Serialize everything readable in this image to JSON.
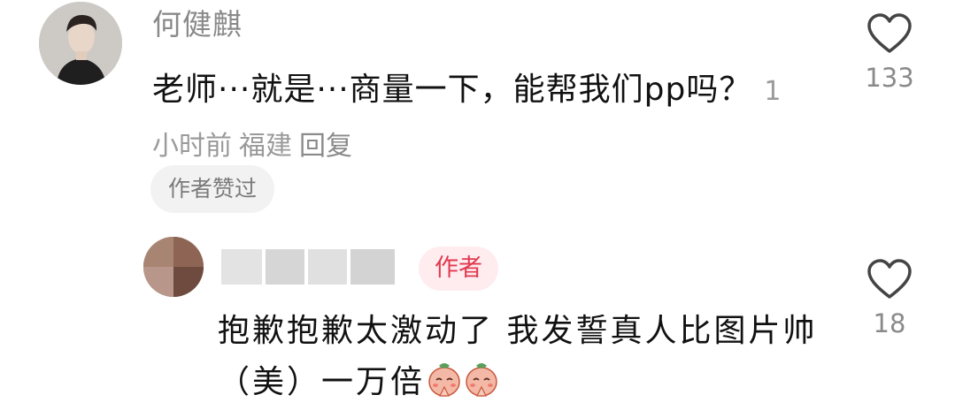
{
  "comment": {
    "username": "何健麒",
    "text": "老师···就是···商量一下，能帮我们pp吗？",
    "time": "1小时前",
    "location": "福建",
    "reply_label": "回复",
    "author_liked_chip": "作者赞过",
    "like_count": "133",
    "like_icon": "heart-outline-icon"
  },
  "reply": {
    "author_tag": "作者",
    "text": "抱歉抱歉太激动了 我发誓真人比图片帅（美）一万倍",
    "emojis": [
      "pray-face-emoji",
      "pray-face-emoji"
    ],
    "like_count": "18",
    "like_icon": "heart-outline-icon"
  },
  "colors": {
    "meta_text": "#9a9a9a",
    "author_tag_bg": "#ffecef",
    "author_tag_text": "#e03a4f"
  }
}
